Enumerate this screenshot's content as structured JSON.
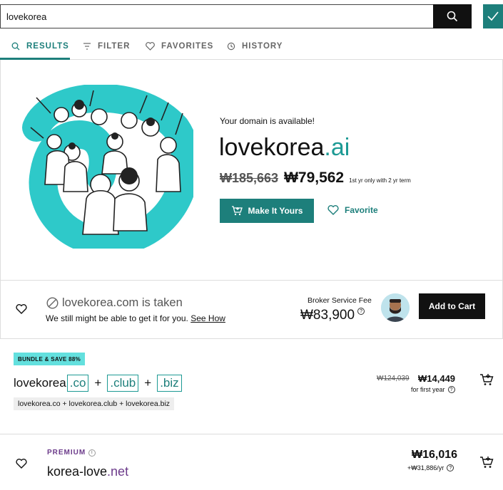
{
  "search": {
    "value": "lovekorea"
  },
  "tabs": [
    {
      "label": "RESULTS",
      "icon": "search-icon",
      "active": true
    },
    {
      "label": "FILTER",
      "icon": "filter-icon",
      "active": false
    },
    {
      "label": "FAVORITES",
      "icon": "heart-icon",
      "active": false
    },
    {
      "label": "HISTORY",
      "icon": "history-icon",
      "active": false
    }
  ],
  "hero": {
    "available_text": "Your domain is available!",
    "domain_name": "lovekorea",
    "domain_tld": ".ai",
    "old_price": "₩185,663",
    "new_price": "₩79,562",
    "term_note": "1st yr only with 2 yr term",
    "make_button": "Make It Yours",
    "favorite_button": "Favorite"
  },
  "taken": {
    "title": "lovekorea.com is taken",
    "subtitle": "We still might be able to get it for you.",
    "see_how": "See How",
    "broker_label": "Broker Service Fee",
    "broker_price": "₩83,900",
    "add_to_cart": "Add to Cart"
  },
  "bundle": {
    "badge": "BUNDLE & SAVE 88%",
    "base": "lovekorea",
    "tlds": [
      ".co",
      ".club",
      ".biz"
    ],
    "list": "lovekorea.co + lovekorea.club + lovekorea.biz",
    "old_price": "₩124,039",
    "new_price": "₩14,449",
    "note": "for first year"
  },
  "premium": {
    "label": "PREMIUM",
    "domain_name": "korea-love",
    "domain_tld": ".net",
    "price": "₩16,016",
    "renewal": "+₩31,886/yr"
  },
  "colors": {
    "accent": "#1d7f7b",
    "tld": "#1d9a94",
    "premium": "#6b3a8a",
    "badge": "#63e0de"
  }
}
